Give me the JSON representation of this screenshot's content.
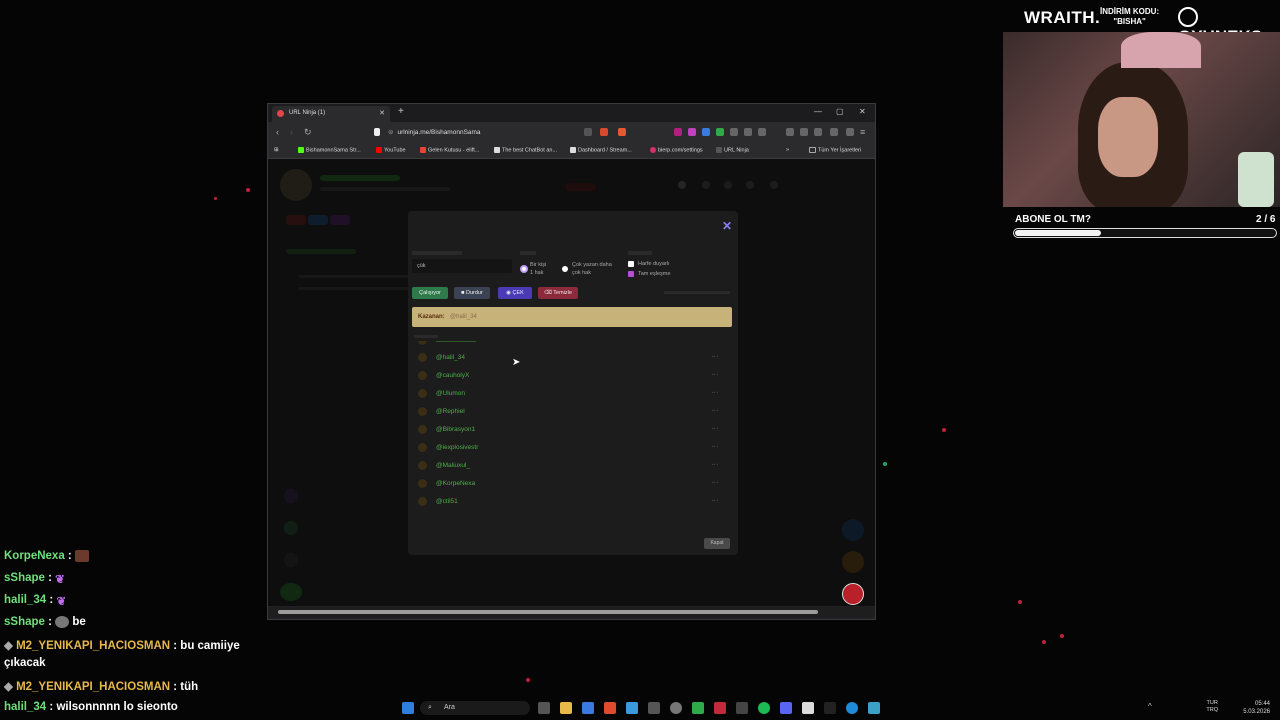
{
  "branding": {
    "wraith": "WRAITH.",
    "code_line1": "İNDİRİM KODU:",
    "code_line2": "\"BISHA\"",
    "oyuneks": "OYUNEKS"
  },
  "goal": {
    "label": "ABONE OL TM?",
    "count": "2 / 6",
    "progress_fraction": 0.333
  },
  "chat": [
    {
      "user": "KorpeNexa",
      "text": "",
      "color": "#6ee07a"
    },
    {
      "user": "sShape",
      "text": "",
      "color": "#6ee07a"
    },
    {
      "user": "halil_34",
      "text": "",
      "color": "#6ee07a"
    },
    {
      "user": "sShape",
      "text": "be",
      "color": "#6ee07a"
    },
    {
      "user": "M2_YENIKAPI_HACIOSMAN",
      "text": "bu camiiye",
      "color": "#e7b84a"
    },
    {
      "user": "",
      "text": "çıkacak",
      "color": "#ffffff"
    },
    {
      "user": "M2_YENIKAPI_HACIOSMAN",
      "text": "tüh",
      "color": "#e7b84a"
    },
    {
      "user": "halil_34",
      "text": "wilsonnnnn lo sieonto",
      "color": "#6ee07a"
    }
  ],
  "browser": {
    "tab_title": "URL Ninja (1)",
    "url": "urlninja.me/BishamonnSama",
    "bookmarks": [
      "BishamonnSama Str...",
      "YouTube",
      "Gelen Kutusu - elift...",
      "The best ChatBot an...",
      "Dashboard / Stream...",
      "bierp.com/settings",
      "URL Ninja"
    ],
    "all_bookmarks": "Tüm Yer İşaretleri"
  },
  "modal": {
    "word_value": "çük",
    "mode_option1": [
      "Bir kişi",
      "1 hak"
    ],
    "mode_option2": [
      "Çok yazan daha",
      "çok hak"
    ],
    "check_case": "Harfe duyarlı",
    "check_exact": "Tam eşleşme",
    "buttons": {
      "running": "Çalışıyor",
      "stop": "Durdur",
      "draw": "ÇEK",
      "clear": "Temizle"
    },
    "winner_label": "Kazanan:",
    "winner_name": "@halil_34",
    "close": "Kapat",
    "participants": [
      "@halil_34",
      "@cauholyX",
      "@Ulumon",
      "@Rephiel",
      "@Bibrasyon1",
      "@iexplosivestr",
      "@Maliuxul_",
      "@KorpeNexa",
      "@ctil51"
    ]
  },
  "taskbar": {
    "search_placeholder": "Ara",
    "lang_top": "TUR",
    "lang_bottom": "TRQ",
    "time": "05:44",
    "date": "5.03.2026"
  }
}
